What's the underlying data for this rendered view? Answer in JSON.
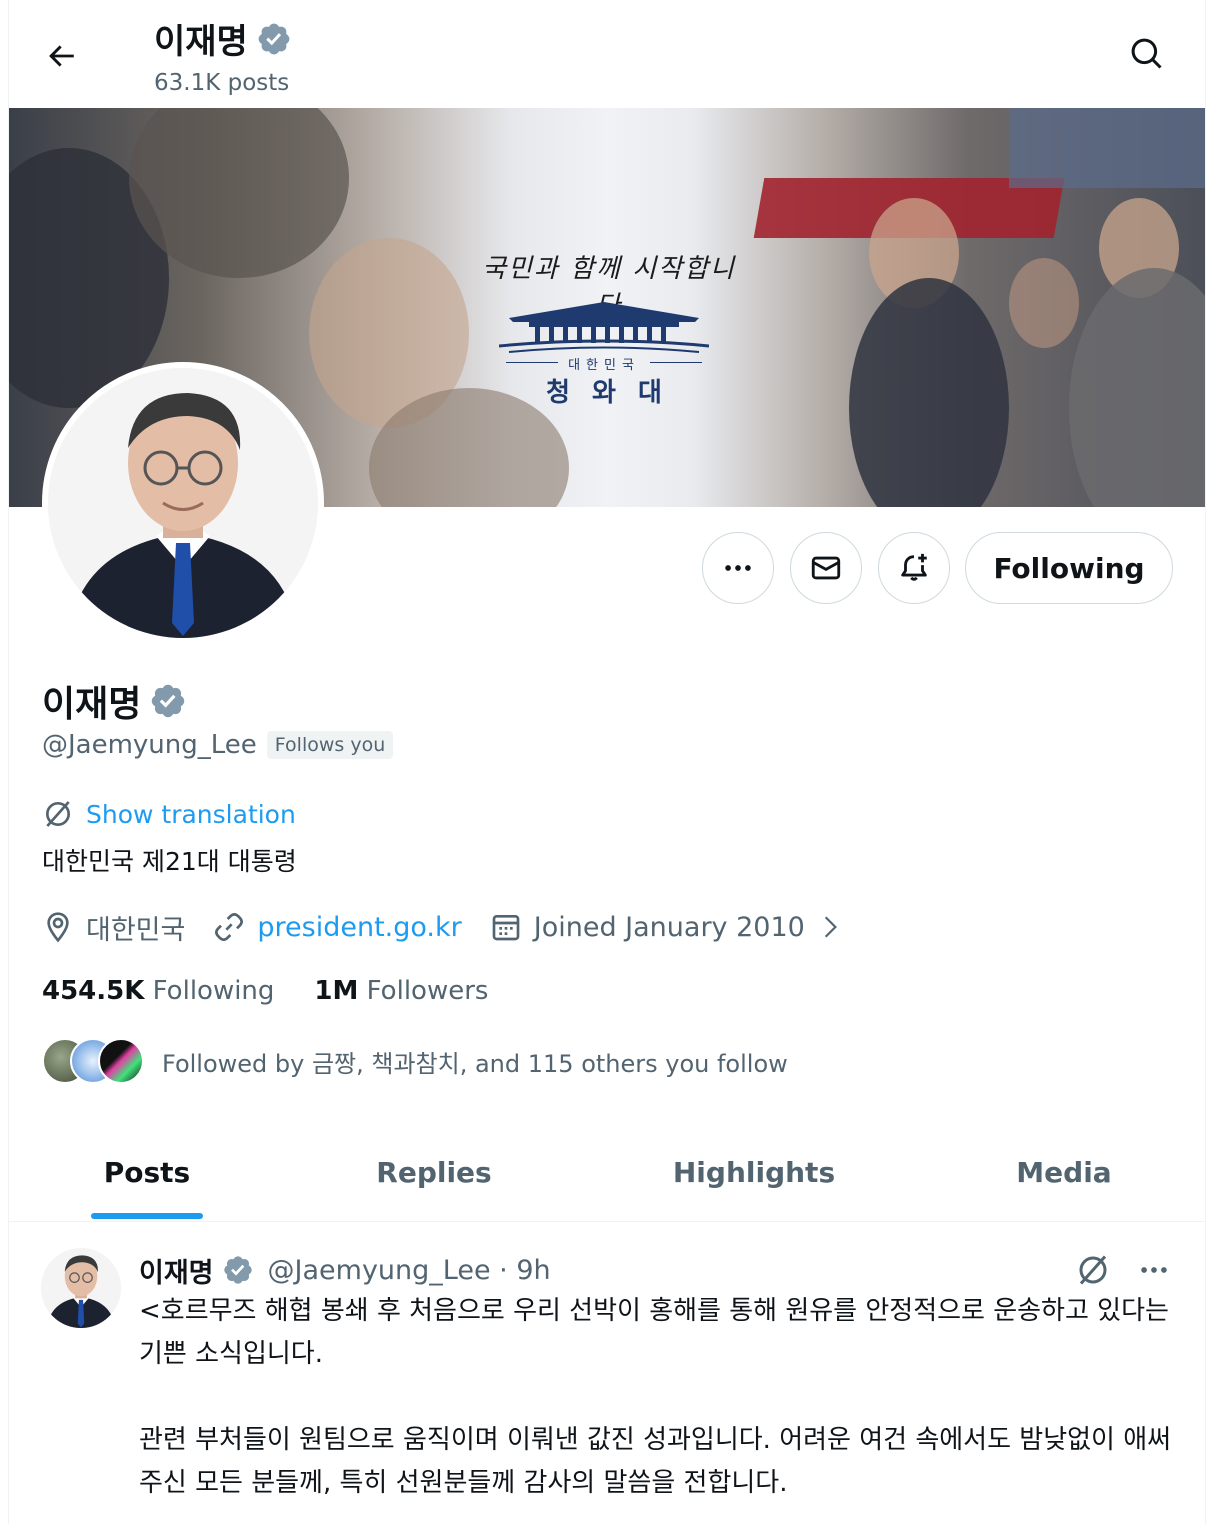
{
  "header": {
    "back_icon": "back-arrow-icon",
    "title": "이재명",
    "post_count": "63.1K posts",
    "search_icon": "search-icon"
  },
  "banner": {
    "slogan": "국민과 함께 시작합니다",
    "emblem_country": "대한민국",
    "emblem_name": "청와대"
  },
  "actions": {
    "more_icon": "more-icon",
    "message_icon": "mail-icon",
    "notify_icon": "bell-plus-icon",
    "following_label": "Following"
  },
  "profile": {
    "name": "이재명",
    "handle": "@Jaemyung_Lee",
    "follows_you": "Follows you",
    "show_translation": "Show translation",
    "bio": "대한민국 제21대 대통령",
    "location": "대한민국",
    "website": "president.go.kr",
    "joined": "Joined January 2010",
    "following_count": "454.5K",
    "following_label": "Following",
    "followers_count": "1M",
    "followers_label": "Followers",
    "followed_by": "Followed by 금짱, 책과참치, and 115 others you follow"
  },
  "tabs": [
    "Posts",
    "Replies",
    "Highlights",
    "Media"
  ],
  "active_tab": "Posts",
  "post": {
    "name": "이재명",
    "handle_time": "@Jaemyung_Lee · 9h",
    "paragraphs": [
      "<호르무즈 해협 봉쇄 후 처음으로 우리 선박이 홍해를 통해 원유를 안정적으로 운송하고 있다는 기쁜 소식입니다.",
      "관련 부처들이 원팀으로 움직이며 이뤄낸 값진 성과입니다. 어려운 여건 속에서도 밤낮없이 애써주신 모든 분들께, 특히 선원분들께 감사의 말씀을 전합니다."
    ]
  },
  "colors": {
    "accent": "#1d9bf0",
    "secondary_text": "#536471",
    "verified_badge": "#829aab"
  }
}
